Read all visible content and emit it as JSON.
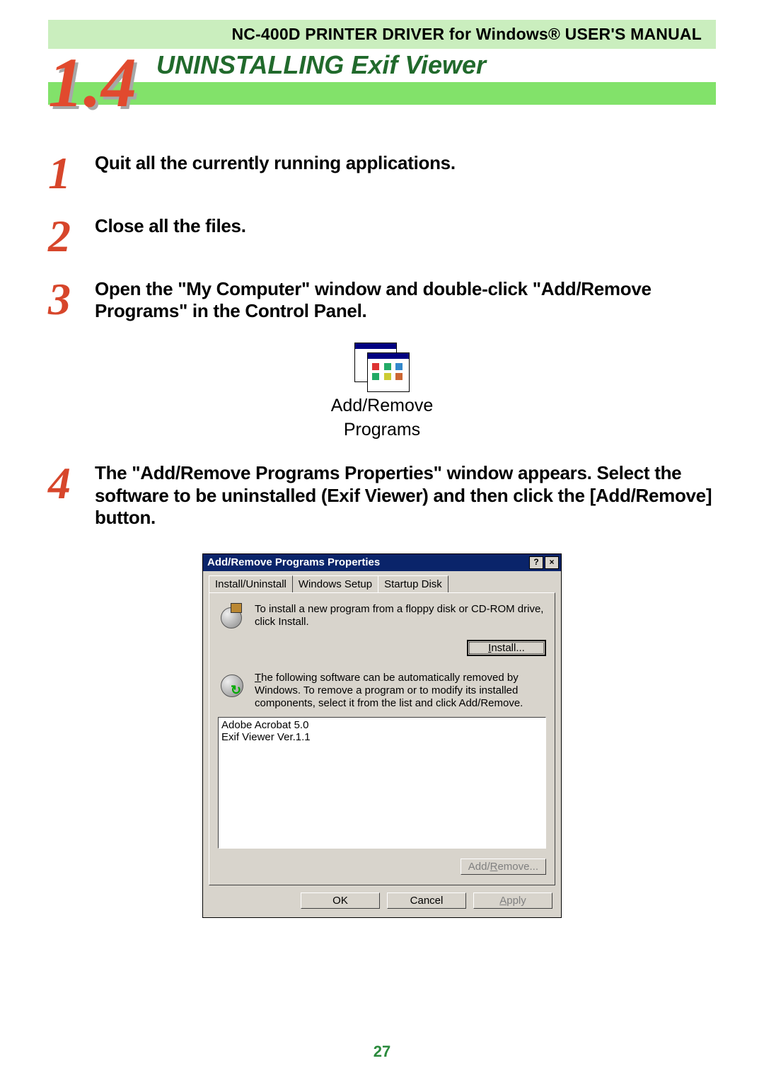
{
  "header": {
    "manual_title": "NC-400D PRINTER DRIVER for Windows® USER'S MANUAL"
  },
  "section": {
    "number": "1.4",
    "title": "UNINSTALLING Exif Viewer"
  },
  "steps": [
    {
      "n": "1",
      "text": "Quit all the currently running applications."
    },
    {
      "n": "2",
      "text": "Close all the files."
    },
    {
      "n": "3",
      "text": "Open the \"My Computer\" window and double-click \"Add/Remove Programs\" in the Control Panel."
    },
    {
      "n": "4",
      "text": "The \"Add/Remove Programs Properties\" window appears. Select the software to be uninstalled (Exif Viewer) and then click the [Add/Remove] button."
    }
  ],
  "cpl_icon_label_l1": "Add/Remove",
  "cpl_icon_label_l2": "Programs",
  "dialog": {
    "title": "Add/Remove Programs Properties",
    "help_btn": "?",
    "close_btn": "×",
    "tabs": {
      "t0": "Install/Uninstall",
      "t1": "Windows Setup",
      "t2": "Startup Disk"
    },
    "install_text": "To install a new program from a floppy disk or CD-ROM drive, click Install.",
    "install_btn": "Install...",
    "remove_text_1": "The following software can be automatically removed by Windows. To remove a program or to modify its installed components, select it from the list and click Add/Remove.",
    "list": {
      "i0": "Adobe Acrobat 5.0",
      "i1": "Exif Viewer Ver.1.1"
    },
    "addremove_btn": "Add/Remove...",
    "ok_btn": "OK",
    "cancel_btn": "Cancel",
    "apply_btn": "Apply"
  },
  "page_number": "27"
}
